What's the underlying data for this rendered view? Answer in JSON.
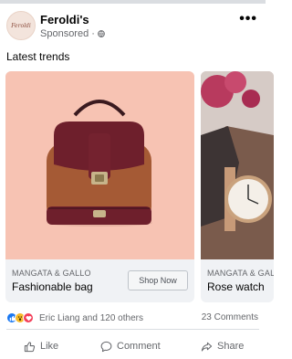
{
  "post": {
    "page_name": "Feroldi's",
    "avatar_logo": "Feroldi",
    "sponsored": "Sponsored",
    "separator": "·",
    "more": "•••",
    "caption": "Latest trends"
  },
  "cards": [
    {
      "brand": "MANGATA & GALLO",
      "title": "Fashionable bag",
      "cta": "Shop Now"
    },
    {
      "brand": "MANGATA & GALLO",
      "title": "Rose watch"
    }
  ],
  "stats": {
    "reactions_text": "Eric Liang and 120 others",
    "comments_text": "23 Comments"
  },
  "actions": {
    "like": "Like",
    "comment": "Comment",
    "share": "Share"
  },
  "colors": {
    "link_blue": "#1877f2",
    "bag_background": "#f7c3b3",
    "bag_brown": "#a55a35",
    "bag_maroon": "#6e1f2c"
  },
  "icons": [
    "globe-icon",
    "more-icon",
    "like-reaction-icon",
    "wow-reaction-icon",
    "love-reaction-icon",
    "thumbs-up-icon",
    "comment-icon",
    "share-icon"
  ]
}
